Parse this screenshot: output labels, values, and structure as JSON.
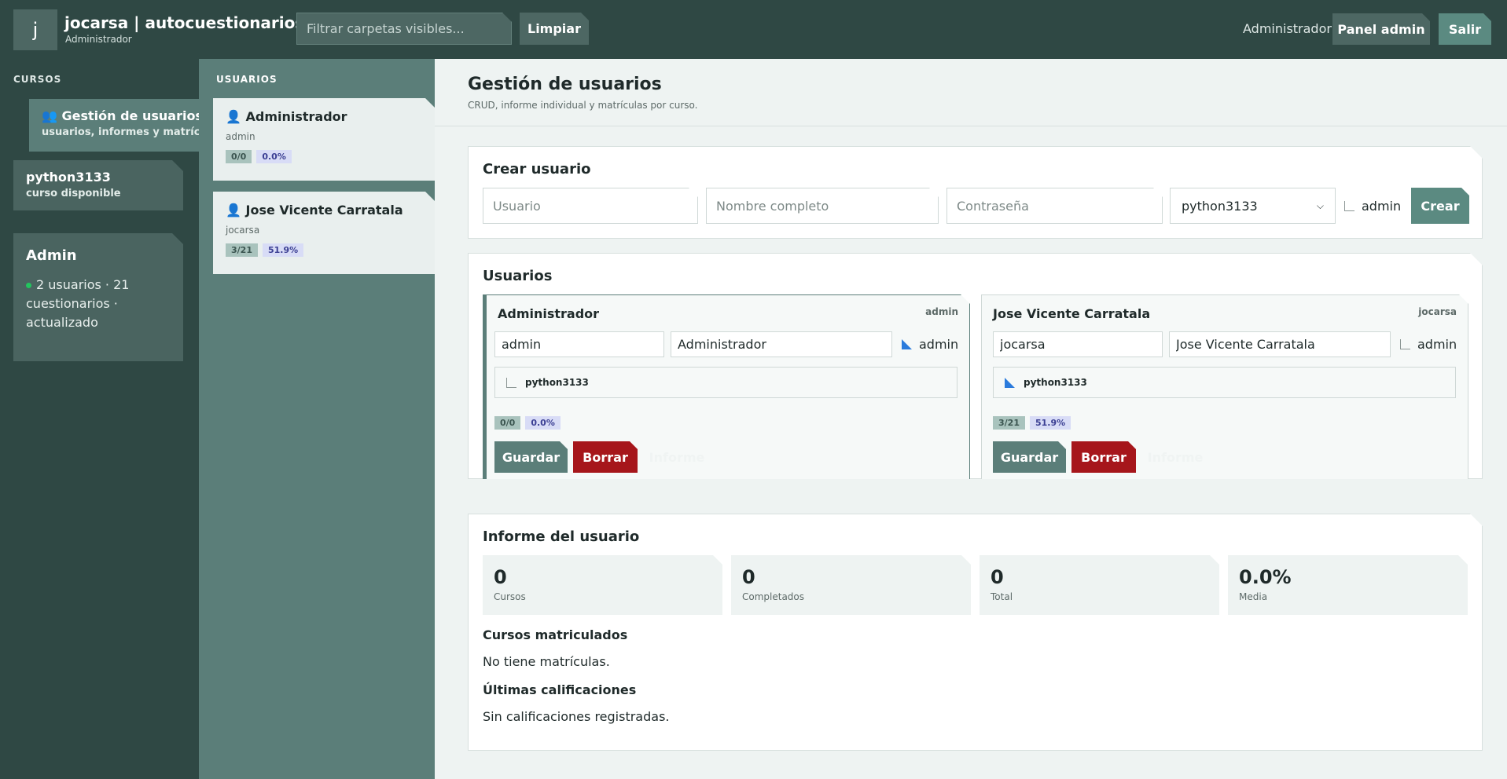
{
  "app": {
    "logo_letter": "j",
    "title": "jocarsa | autocuestionarios",
    "role": "Administrador"
  },
  "topbar": {
    "filter_placeholder": "Filtrar carpetas visibles...",
    "clear_label": "Limpiar",
    "user_label": "Administrador",
    "admin_panel_label": "Panel admin",
    "logout_label": "Salir"
  },
  "sidebar": {
    "heading": "CURSOS",
    "active_item": {
      "title": "👥 Gestión de usuarios",
      "subtitle": "usuarios, informes y matrículas"
    },
    "course_item": {
      "title": "python3133",
      "subtitle": "curso disponible"
    },
    "admin_card": {
      "title": "Admin",
      "status": "2 usuarios · 21 cuestionarios · actualizado",
      "status_color": "#22c55e"
    }
  },
  "users_column": {
    "heading": "USUARIOS",
    "users": [
      {
        "name": "👤 Administrador",
        "login": "admin",
        "progress": "0/0",
        "percent": "0.0%"
      },
      {
        "name": "👤 Jose Vicente Carratala",
        "login": "jocarsa",
        "progress": "3/21",
        "percent": "51.9%"
      }
    ]
  },
  "main": {
    "title": "Gestión de usuarios",
    "subtitle": "CRUD, informe individual y matrículas por curso.",
    "create": {
      "title": "Crear usuario",
      "username_placeholder": "Usuario",
      "fullname_placeholder": "Nombre completo",
      "password_placeholder": "Contraseña",
      "course_selected": "python3133",
      "admin_label": "admin",
      "create_label": "Crear"
    },
    "users_panel": {
      "title": "Usuarios",
      "cards": [
        {
          "name": "Administrador",
          "login": "admin",
          "username_value": "admin",
          "fullname_value": "Administrador",
          "admin_label": "admin",
          "admin_checked": true,
          "course": "python3133",
          "course_checked": false,
          "progress": "0/0",
          "percent": "0.0%",
          "save_label": "Guardar",
          "delete_label": "Borrar",
          "report_label": "Informe"
        },
        {
          "name": "Jose Vicente Carratala",
          "login": "jocarsa",
          "username_value": "jocarsa",
          "fullname_value": "Jose Vicente Carratala",
          "admin_label": "admin",
          "admin_checked": false,
          "course": "python3133",
          "course_checked": true,
          "progress": "3/21",
          "percent": "51.9%",
          "save_label": "Guardar",
          "delete_label": "Borrar",
          "report_label": "Informe"
        }
      ]
    },
    "report": {
      "title": "Informe del usuario",
      "stats": [
        {
          "value": "0",
          "label": "Cursos"
        },
        {
          "value": "0",
          "label": "Completados"
        },
        {
          "value": "0",
          "label": "Total"
        },
        {
          "value": "0.0%",
          "label": "Media"
        }
      ],
      "enrolled_heading": "Cursos matriculados",
      "enrolled_text": "No tiene matrículas.",
      "grades_heading": "Últimas calificaciones",
      "grades_text": "Sin calificaciones registradas."
    }
  },
  "colors": {
    "topbar": "#2f4844",
    "accent": "#5b8a81",
    "danger": "#a6161b",
    "users_column": "#5b7e79"
  }
}
